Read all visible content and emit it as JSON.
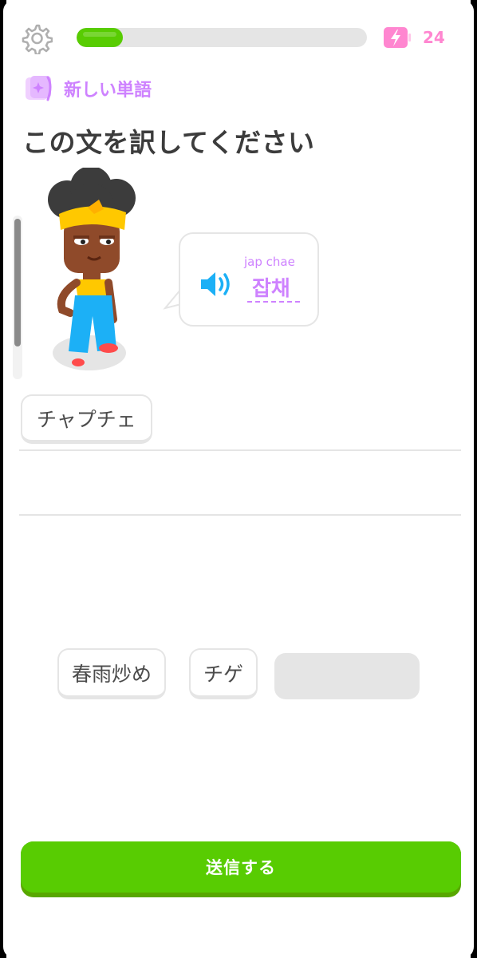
{
  "header": {
    "progress_fraction": 0.16,
    "energy_count": "24",
    "icons": {
      "settings": "gear-icon",
      "energy": "battery-icon"
    },
    "colors": {
      "progress": "#58cc02",
      "energy": "#ff86d0"
    }
  },
  "badge": {
    "label": "新しい単語",
    "icon": "sparkle-card-icon",
    "color": "#ce82ff"
  },
  "prompt": {
    "title": "この文を訳してください",
    "romanization": "jap chae",
    "korean": "잡채",
    "speaker_icon": "speaker-icon"
  },
  "answer": {
    "selected_words": [
      "チャプチェ"
    ]
  },
  "word_bank": {
    "words": [
      "春雨炒め",
      "チゲ"
    ]
  },
  "submit": {
    "label": "送信する",
    "color": "#58cc02"
  }
}
